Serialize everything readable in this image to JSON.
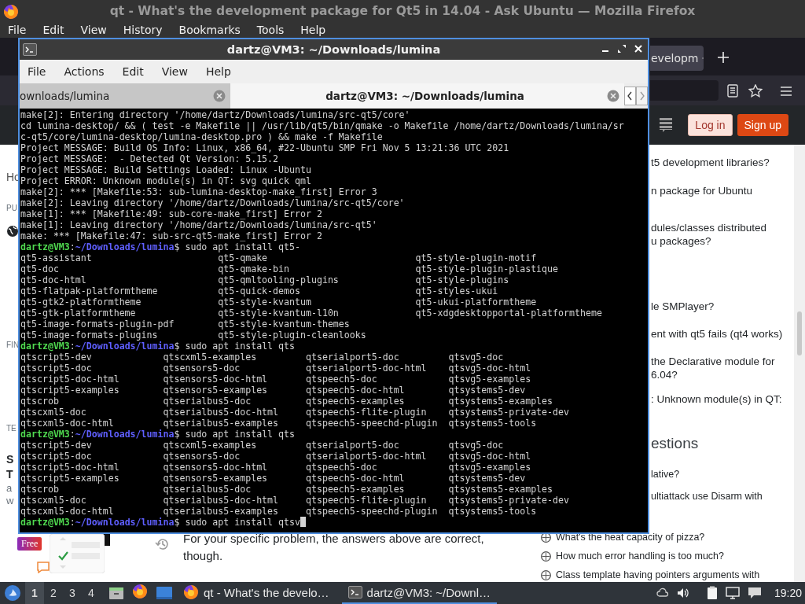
{
  "browser": {
    "title": "qt - What's the development package for Qt5 in 14.04 - Ask Ubuntu — Mozilla Firefox",
    "menu": [
      "File",
      "Edit",
      "View",
      "History",
      "Bookmarks",
      "Tools",
      "Help"
    ],
    "tab_fragment": "evelopm",
    "page": {
      "login": "Log in",
      "signup": "Sign up",
      "left_fragments": [
        {
          "kind": "title",
          "text": "Ho"
        },
        {
          "kind": "caption",
          "text": "PU"
        },
        {
          "kind": "globe"
        },
        {
          "kind": "caption",
          "text": "FIN"
        },
        {
          "kind": "caption",
          "text": "TE"
        },
        {
          "kind": "bold",
          "text": "S"
        },
        {
          "kind": "bold",
          "text": "T"
        },
        {
          "kind": "plain",
          "text": "a"
        },
        {
          "kind": "plain",
          "text": "w"
        }
      ],
      "related": [
        {
          "lines": [
            "t5 development libraries?"
          ]
        },
        {
          "lines": [
            "n package for Ubuntu"
          ]
        },
        {
          "lines": [
            "dules/classes distributed",
            "u packages?"
          ]
        },
        {
          "lines": [
            "le SMPlayer?"
          ]
        },
        {
          "lines": [
            "ent with qt5 fails (qt4 works)"
          ]
        },
        {
          "lines": [
            "the Declarative module for",
            "6.04?"
          ]
        },
        {
          "lines": [
            ": Unknown module(s) in QT:"
          ]
        }
      ],
      "hot_heading": "estions",
      "hot_fragments": [
        "lative?",
        "ultiattack use Disarm with"
      ],
      "hot_questions": [
        "What's the heat capacity of pizza?",
        "How much error handling is too much?",
        "Class template having pointers arguments with"
      ],
      "ad_badge": "Free",
      "answer_text": "For your specific problem, the answers above are correct, though."
    }
  },
  "terminal": {
    "title": "dartz@VM3: ~/Downloads/lumina",
    "menu": [
      "File",
      "Actions",
      "Edit",
      "View",
      "Help"
    ],
    "tabs": [
      {
        "label": "ownloads/lumina",
        "selected": false
      },
      {
        "label": "dartz@VM3: ~/Downloads/lumina",
        "selected": true
      }
    ],
    "lines": [
      {
        "kind": "output",
        "text": "make[2]: Entering directory '/home/dartz/Downloads/lumina/src-qt5/core'"
      },
      {
        "kind": "output",
        "text": "cd lumina-desktop/ && ( test -e Makefile || /usr/lib/qt5/bin/qmake -o Makefile /home/dartz/Downloads/lumina/sr"
      },
      {
        "kind": "output",
        "text": "c-qt5/core/lumina-desktop/lumina-desktop.pro ) && make -f Makefile"
      },
      {
        "kind": "output",
        "text": "Project MESSAGE: Build OS Info: Linux, x86_64, #22-Ubuntu SMP Fri Nov 5 13:21:36 UTC 2021"
      },
      {
        "kind": "output",
        "text": "Project MESSAGE:  - Detected Qt Version: 5.15.2"
      },
      {
        "kind": "output",
        "text": "Project MESSAGE: Build Settings Loaded: Linux -Ubuntu"
      },
      {
        "kind": "output",
        "text": "Project ERROR: Unknown module(s) in QT: svg quick qml"
      },
      {
        "kind": "output",
        "text": "make[2]: *** [Makefile:53: sub-lumina-desktop-make_first] Error 3"
      },
      {
        "kind": "output",
        "text": "make[2]: Leaving directory '/home/dartz/Downloads/lumina/src-qt5/core'"
      },
      {
        "kind": "output",
        "text": "make[1]: *** [Makefile:49: sub-core-make_first] Error 2"
      },
      {
        "kind": "output",
        "text": "make[1]: Leaving directory '/home/dartz/Downloads/lumina/src-qt5'"
      },
      {
        "kind": "output",
        "text": "make: *** [Makefile:47: sub-src-qt5-make_first] Error 2"
      },
      {
        "kind": "prompt",
        "user": "dartz@VM3",
        "path": "~/Downloads/lumina",
        "sep": ":",
        "symbol": "$",
        "command": "sudo apt install qt5-",
        "cursor": false
      },
      {
        "kind": "listing",
        "rows": [
          [
            "qt5-assistant",
            "qt5-qmake",
            "qt5-style-plugin-motif"
          ],
          [
            "qt5-doc",
            "qt5-qmake-bin",
            "qt5-style-plugin-plastique"
          ],
          [
            "qt5-doc-html",
            "qt5-qmltooling-plugins",
            "qt5-style-plugins"
          ],
          [
            "qt5-flatpak-platformtheme",
            "qt5-quick-demos",
            "qt5-styles-ukui"
          ],
          [
            "qt5-gtk2-platformtheme",
            "qt5-style-kvantum",
            "qt5-ukui-platformtheme"
          ],
          [
            "qt5-gtk-platformtheme",
            "qt5-style-kvantum-l10n",
            "qt5-xdgdesktopportal-platformtheme"
          ],
          [
            "qt5-image-formats-plugin-pdf",
            "qt5-style-kvantum-themes"
          ],
          [
            "qt5-image-formats-plugins",
            "qt5-style-plugin-cleanlooks"
          ]
        ]
      },
      {
        "kind": "prompt",
        "user": "dartz@VM3",
        "path": "~/Downloads/lumina",
        "sep": ":",
        "symbol": "$",
        "command": "sudo apt install qts",
        "cursor": false
      },
      {
        "kind": "listing",
        "rows": [
          [
            "qtscript5-dev",
            "qtscxml5-examples",
            "qtserialport5-doc",
            "qtsvg5-doc"
          ],
          [
            "qtscript5-doc",
            "qtsensors5-doc",
            "qtserialport5-doc-html",
            "qtsvg5-doc-html"
          ],
          [
            "qtscript5-doc-html",
            "qtsensors5-doc-html",
            "qtspeech5-doc",
            "qtsvg5-examples"
          ],
          [
            "qtscript5-examples",
            "qtsensors5-examples",
            "qtspeech5-doc-html",
            "qtsystems5-dev"
          ],
          [
            "qtscrob",
            "qtserialbus5-doc",
            "qtspeech5-examples",
            "qtsystems5-examples"
          ],
          [
            "qtscxml5-doc",
            "qtserialbus5-doc-html",
            "qtspeech5-flite-plugin",
            "qtsystems5-private-dev"
          ],
          [
            "qtscxml5-doc-html",
            "qtserialbus5-examples",
            "qtspeech5-speechd-plugin",
            "qtsystems5-tools"
          ]
        ]
      },
      {
        "kind": "prompt",
        "user": "dartz@VM3",
        "path": "~/Downloads/lumina",
        "sep": ":",
        "symbol": "$",
        "command": "sudo apt install qts",
        "cursor": false
      },
      {
        "kind": "listing",
        "rows": [
          [
            "qtscript5-dev",
            "qtscxml5-examples",
            "qtserialport5-doc",
            "qtsvg5-doc"
          ],
          [
            "qtscript5-doc",
            "qtsensors5-doc",
            "qtserialport5-doc-html",
            "qtsvg5-doc-html"
          ],
          [
            "qtscript5-doc-html",
            "qtsensors5-doc-html",
            "qtspeech5-doc",
            "qtsvg5-examples"
          ],
          [
            "qtscript5-examples",
            "qtsensors5-examples",
            "qtspeech5-doc-html",
            "qtsystems5-dev"
          ],
          [
            "qtscrob",
            "qtserialbus5-doc",
            "qtspeech5-examples",
            "qtsystems5-examples"
          ],
          [
            "qtscxml5-doc",
            "qtserialbus5-doc-html",
            "qtspeech5-flite-plugin",
            "qtsystems5-private-dev"
          ],
          [
            "qtscxml5-doc-html",
            "qtserialbus5-examples",
            "qtspeech5-speechd-plugin",
            "qtsystems5-tools"
          ]
        ]
      },
      {
        "kind": "prompt",
        "user": "dartz@VM3",
        "path": "~/Downloads/lumina",
        "sep": ":",
        "symbol": "$",
        "command": "sudo apt install qtsv",
        "cursor": true
      }
    ]
  },
  "taskbar": {
    "workspaces": [
      {
        "label": "1",
        "selected": true
      },
      {
        "label": "2",
        "selected": false
      },
      {
        "label": "3",
        "selected": false
      },
      {
        "label": "4",
        "selected": false
      }
    ],
    "tasks": [
      {
        "kind": "browser",
        "label": "qt - What's the develo…",
        "selected": false
      },
      {
        "kind": "terminal",
        "label": "dartz@VM3: ~/Downl…",
        "selected": true
      }
    ],
    "clock": "19:20"
  }
}
